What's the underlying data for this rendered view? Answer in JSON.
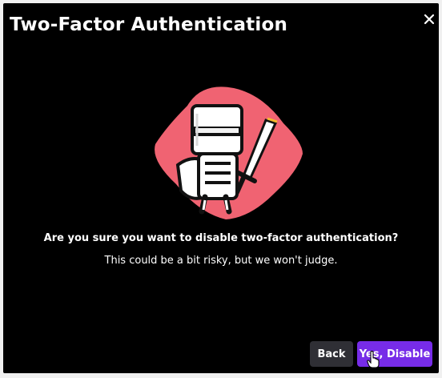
{
  "modal": {
    "title": "Two-Factor Authentication",
    "close_icon": "close-icon",
    "illustration": "knight-with-sword-illustration",
    "question": "Are you sure you want to disable two-factor authentication?",
    "subtext": "This could be a bit risky, but we won't judge.",
    "buttons": {
      "back_label": "Back",
      "disable_label": "Yes, Disable"
    }
  },
  "cursor": "hand-pointer-icon",
  "colors": {
    "background": "#000000",
    "primary_button": "#772ce8",
    "secondary_button": "#2f2f35",
    "illustration_backdrop": "#f06372",
    "text": "#ffffff"
  }
}
